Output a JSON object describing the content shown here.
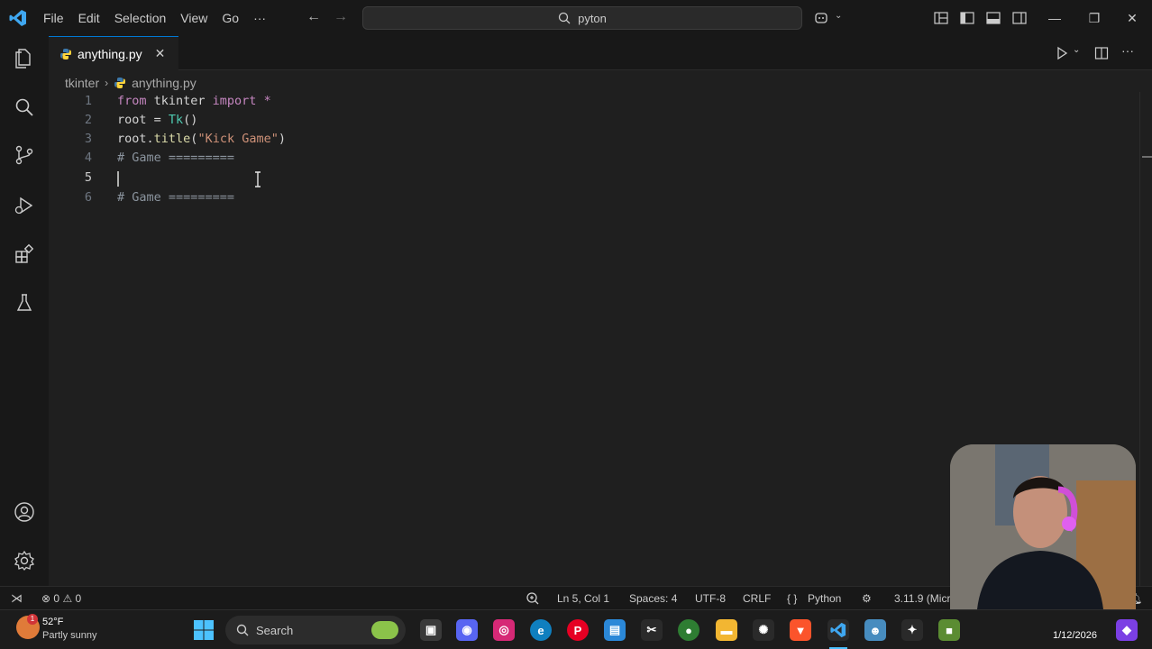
{
  "menu": {
    "file": "File",
    "edit": "Edit",
    "selection": "Selection",
    "view": "View",
    "go": "Go",
    "more": "···"
  },
  "command_center": {
    "text": "pyton"
  },
  "tab": {
    "label": "anything.py"
  },
  "breadcrumb": {
    "folder": "tkinter",
    "file": "anything.py"
  },
  "code_lines": [
    {
      "n": "1"
    },
    {
      "n": "2"
    },
    {
      "n": "3"
    },
    {
      "n": "4"
    },
    {
      "n": "5"
    },
    {
      "n": "6"
    }
  ],
  "code": {
    "l1_from": "from",
    "l1_mod": " tkinter ",
    "l1_import": "import",
    "l1_star": " *",
    "l2_root": "root",
    "l2_eq": " = ",
    "l2_tk": "Tk",
    "l2_paren": "()",
    "l3_root": "root",
    "l3_dot": ".",
    "l3_title": "title",
    "l3_open": "(",
    "l3_str": "\"Kick Game\"",
    "l3_close": ")",
    "l4_comment": "# Game =========",
    "l6_comment": "# Game ========="
  },
  "status": {
    "errors": "0",
    "warnings": "0",
    "position": "Ln 5, Col 1",
    "spaces": "Spaces: 4",
    "encoding": "UTF-8",
    "eol": "CRLF",
    "language": "Python",
    "interpreter": "3.11.9 (Micr"
  },
  "taskbar": {
    "weather_temp": "52°F",
    "weather_desc": "Partly sunny",
    "weather_badge": "1",
    "search": "Search",
    "date": "1/12/2026"
  },
  "colors": {
    "accent": "#0078d4",
    "keyword": "#c586c0",
    "function": "#dcdcaa",
    "string": "#ce9178",
    "class": "#4ec9b0"
  }
}
